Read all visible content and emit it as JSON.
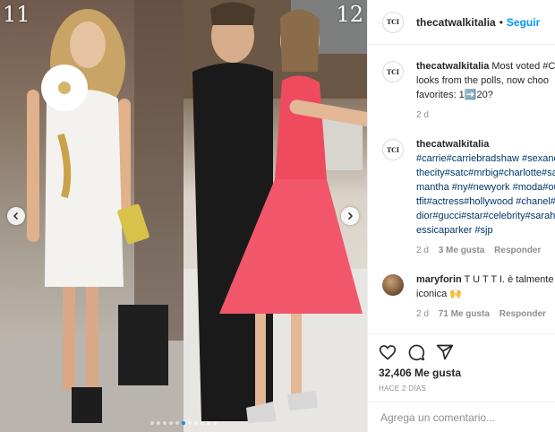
{
  "media": {
    "left_number": "11",
    "right_number": "12"
  },
  "post": {
    "username": "thecatwalkitalia",
    "separator": "•",
    "follow_label": "Seguir",
    "brand_avatar_text": "TCI"
  },
  "comments": [
    {
      "username": "thecatwalkitalia",
      "text_line1": "Most voted #C",
      "text_line2": "looks from the polls, now choo",
      "text_line3": "favorites: 1➡️20?",
      "time": "2 d"
    },
    {
      "username": "thecatwalkitalia",
      "hashtags": "#carrie#carriebradshaw #sexandthecity#satc#mrbig#charlotte#samantha #ny#newyork #moda#outfit#actress#hollywood #chanel#dior#gucci#star#celebrity#sarahjessicaparker #sjp",
      "time": "2 d",
      "likes": "3 Me gusta",
      "reply_label": "Responder"
    },
    {
      "username": "maryforin",
      "text_line1": "T U T T I. è talmente",
      "text_line2": "iconica 🙌",
      "time": "2 d",
      "likes": "71 Me gusta",
      "reply_label": "Responder"
    }
  ],
  "actions": {
    "likes_count": "32,406 Me gusta",
    "time_ago": "HACE 2 DÍAS"
  },
  "add_comment": {
    "placeholder": "Agrega un comentario..."
  },
  "colors": {
    "accent": "#0095f6",
    "hashtag": "#00376b",
    "muted": "#8e8e8e"
  }
}
